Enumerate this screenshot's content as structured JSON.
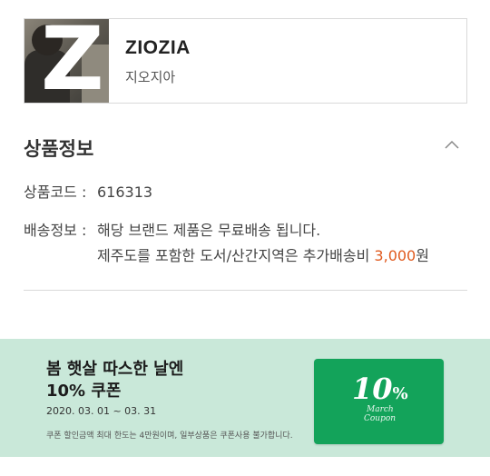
{
  "brand": {
    "logo_letter": "Z",
    "name": "ZIOZIA",
    "name_kr": "지오지아"
  },
  "product_info": {
    "title": "상품정보",
    "code_label": "상품코드 :",
    "code_value": "616313",
    "shipping_label": "배송정보 :",
    "shipping_line1": "해당 브랜드 제품은 무료배송 됩니다.",
    "shipping_line2_prefix": "제주도를 포함한 도서/산간지역은 추가배송비 ",
    "shipping_fee": "3,000",
    "shipping_fee_unit": "원"
  },
  "banner": {
    "headline1": "봄 햇살 따스한 날엔",
    "headline2": "10% 쿠폰",
    "period": "2020. 03. 01 ~ 03. 31",
    "note": "쿠폰 할인금액 최대 한도는 4만원이며, 일부상품은 쿠폰사용 불가합니다.",
    "coupon_number": "10",
    "coupon_percent": "%",
    "coupon_line1": "March",
    "coupon_line2": "Coupon"
  },
  "colors": {
    "accent_price": "#e05a1e",
    "banner_bg": "#c9e8d9",
    "coupon_bg": "#13a35a"
  }
}
